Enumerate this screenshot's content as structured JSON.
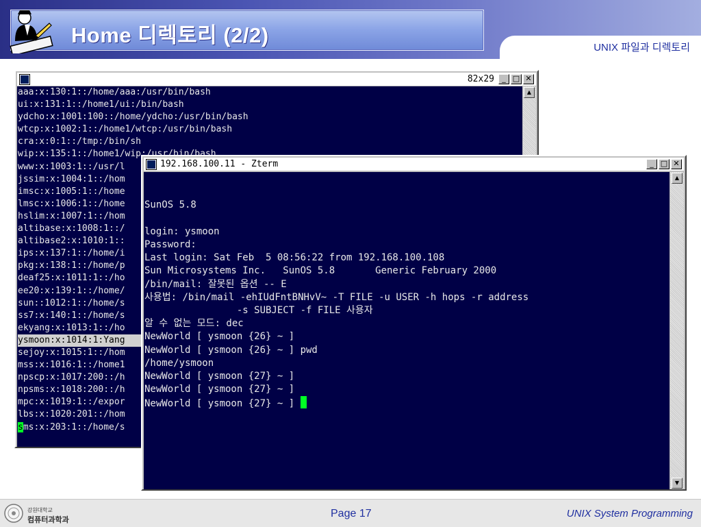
{
  "slide": {
    "title": "Home 디렉토리 (2/2)",
    "subtitle": "UNIX 파일과 디렉토리",
    "page": "Page 17",
    "course": "UNIX System Programming"
  },
  "university": {
    "line1": "강원대학교",
    "line2": "컴퓨터과학과"
  },
  "back_window": {
    "size": "82x29",
    "lines": [
      "aaa:x:130:1::/home/aaa:/usr/bin/bash",
      "ui:x:131:1::/home1/ui:/bin/bash",
      "ydcho:x:1001:100::/home/ydcho:/usr/bin/bash",
      "wtcp:x:1002:1::/home1/wtcp:/usr/bin/bash",
      "cra:x:0:1::/tmp:/bin/sh",
      "wip:x:135:1::/home1/wip:/usr/bin/bash",
      "www:x:1003:1::/usr/l",
      "jssim:x:1004:1::/hom",
      "imsc:x:1005:1::/home",
      "lmsc:x:1006:1::/home",
      "hslim:x:1007:1::/hom",
      "altibase:x:1008:1::/",
      "altibase2:x:1010:1::",
      "ips:x:137:1::/home/i",
      "pkg:x:138:1::/home/p",
      "deaf25:x:1011:1::/ho",
      "ee20:x:139:1::/home/",
      "sun::1012:1::/home/s",
      "ss7:x:140:1::/home/s",
      "ekyang:x:1013:1::/ho",
      "ysmoon:x:1014:1:Yang",
      "sejoy:x:1015:1::/hom",
      "mss:x:1016:1::/home1",
      "npscp:x:1017:200::/h",
      "npsms:x:1018:200::/h",
      "mpc:x:1019:1::/expor",
      "lbs:x:1020:201::/hom",
      "ms:x:203:1::/home/s"
    ],
    "highlight_index": 20,
    "last_cursor_char": "s"
  },
  "front_window": {
    "title": "192.168.100.11 - Zterm",
    "lines": [
      "",
      "",
      "SunOS 5.8",
      "",
      "login: ysmoon",
      "Password:",
      "Last login: Sat Feb  5 08:56:22 from 192.168.100.108",
      "Sun Microsystems Inc.   SunOS 5.8       Generic February 2000",
      "/bin/mail: 잘못된 옵션 -- E",
      "사용법: /bin/mail -ehIUdFntBNHvV~ -T FILE -u USER -h hops -r address",
      "                -s SUBJECT -f FILE 사용자",
      "알 수 없는 모드: dec",
      "NewWorld [ ysmoon {26} ~ ]",
      "NewWorld [ ysmoon {26} ~ ] pwd",
      "/home/ysmoon",
      "NewWorld [ ysmoon {27} ~ ]",
      "NewWorld [ ysmoon {27} ~ ]",
      "NewWorld [ ysmoon {27} ~ ] "
    ]
  },
  "icons": {
    "minimize": "minimize-icon",
    "maximize": "maximize-icon",
    "close": "close-icon",
    "scroll_up": "arrow-up-icon",
    "scroll_down": "arrow-down-icon"
  },
  "colors": {
    "terminal_bg": "#000046",
    "cursor": "#00ff24",
    "accent": "#1f2fa0"
  }
}
